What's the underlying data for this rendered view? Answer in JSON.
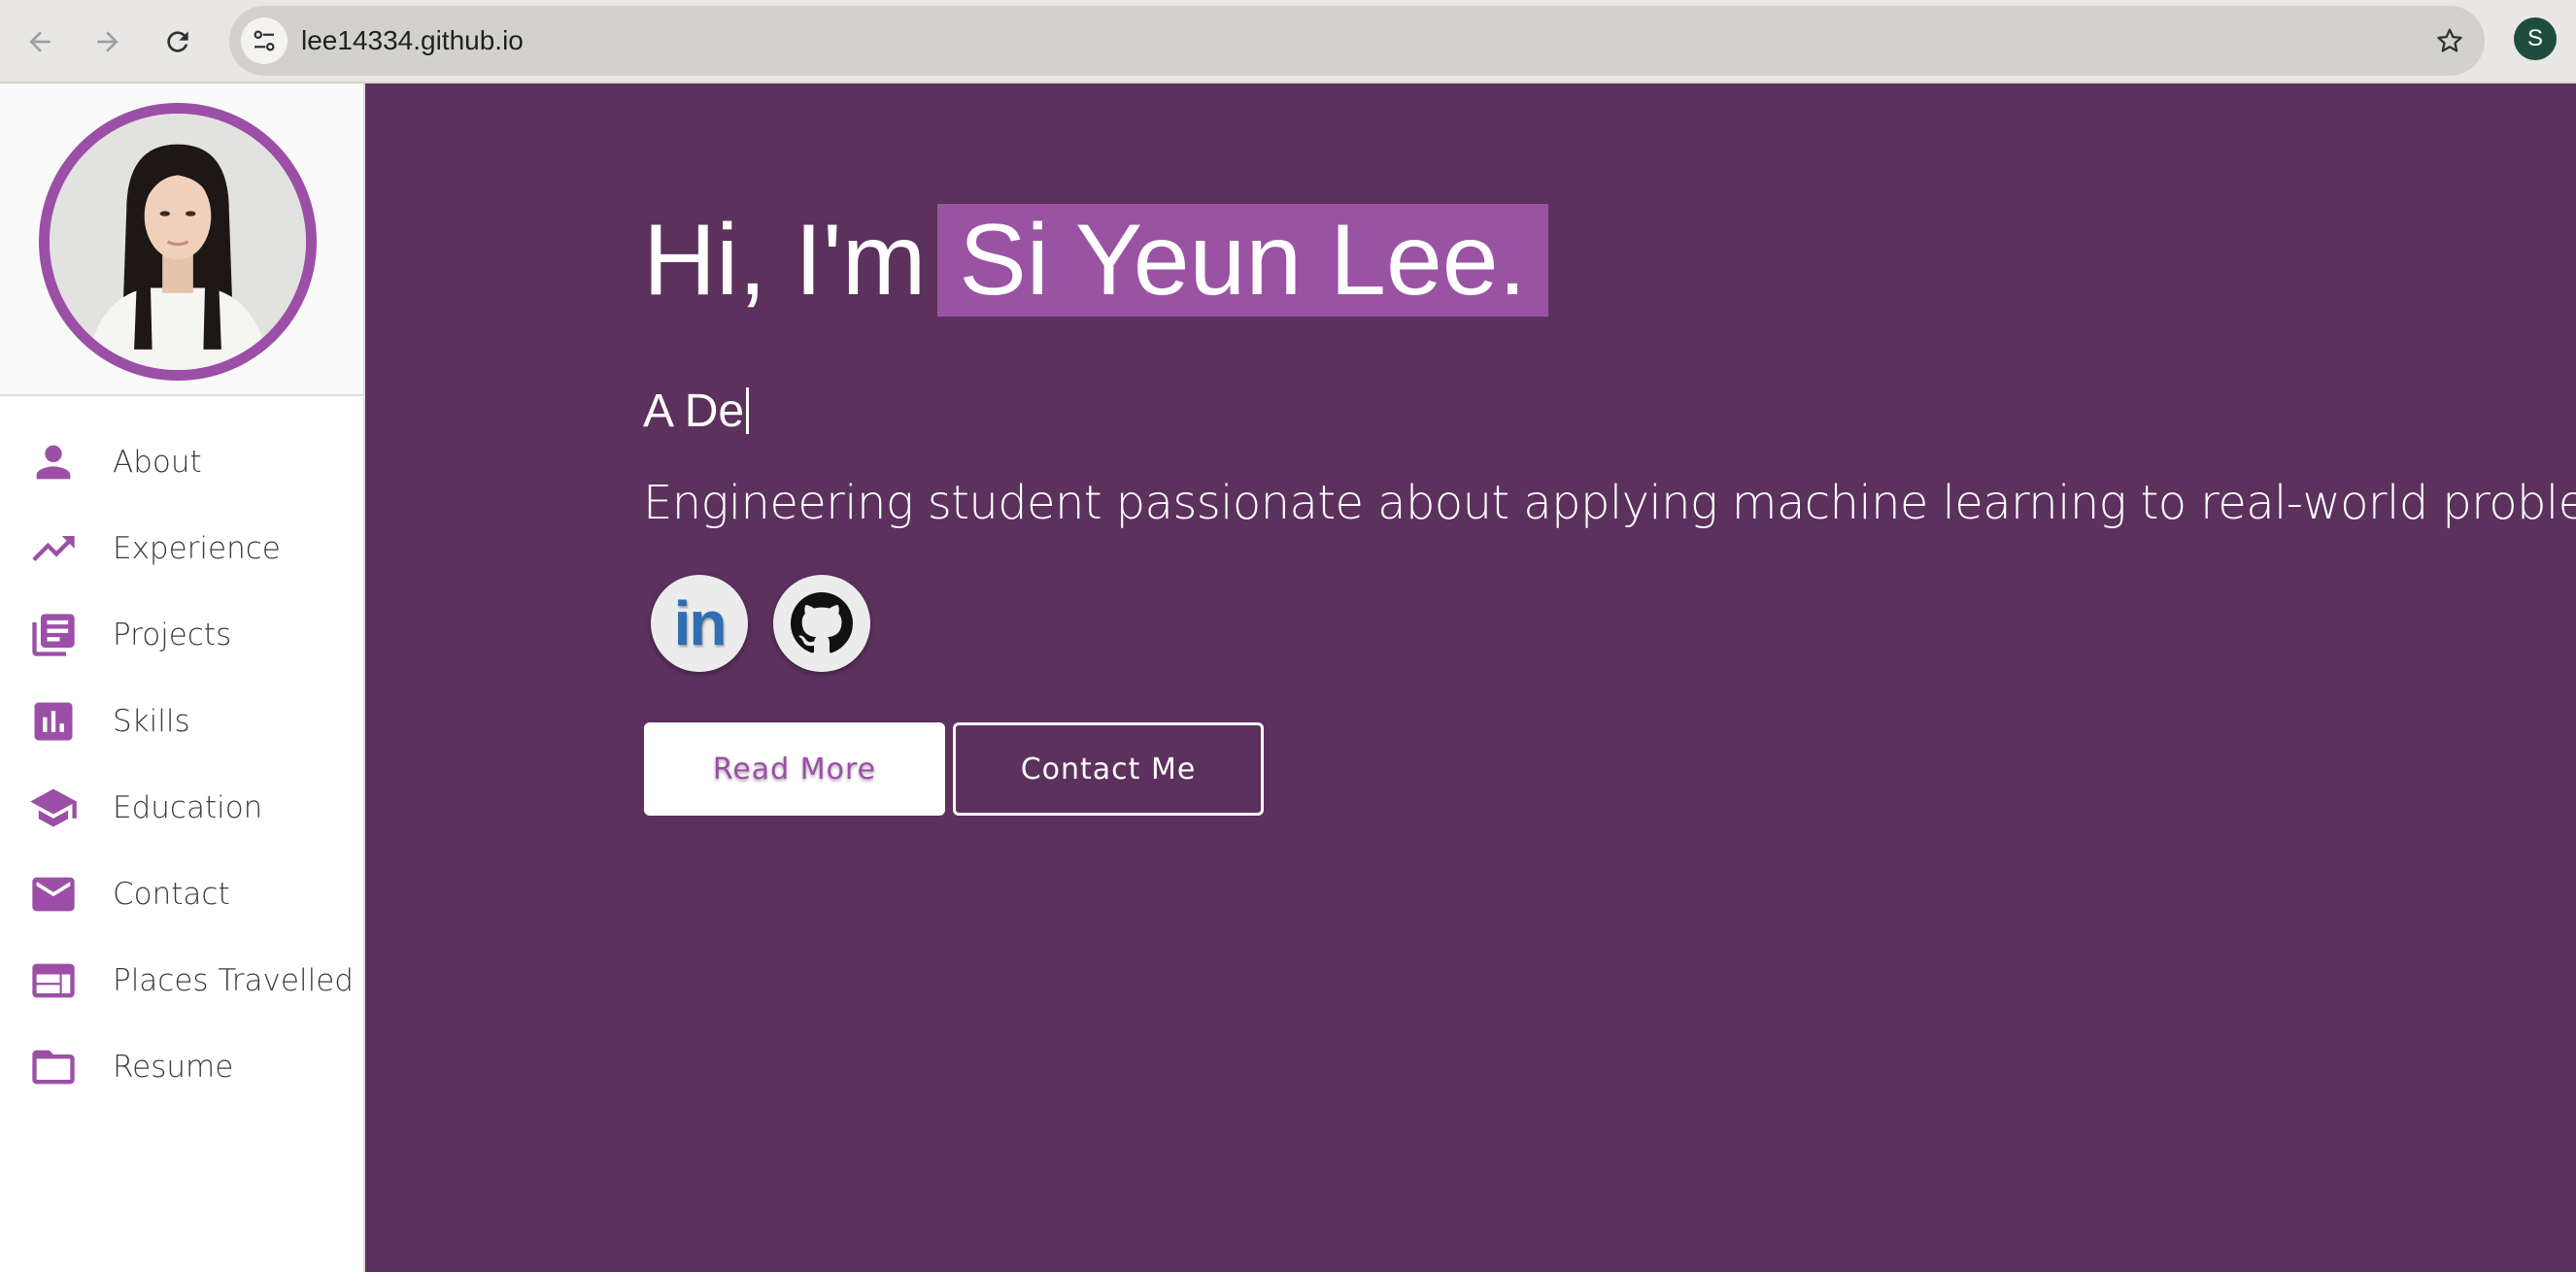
{
  "browser": {
    "url": "lee14334.github.io",
    "profile_initial": "S",
    "icons": [
      "back-arrow-icon",
      "forward-arrow-icon",
      "reload-icon",
      "site-settings-icon",
      "bookmark-star-icon"
    ]
  },
  "sidebar": {
    "items": [
      {
        "label": "About",
        "icon": "person-icon"
      },
      {
        "label": "Experience",
        "icon": "trending-up-icon"
      },
      {
        "label": "Projects",
        "icon": "library-books-icon"
      },
      {
        "label": "Skills",
        "icon": "bar-chart-icon"
      },
      {
        "label": "Education",
        "icon": "graduation-cap-icon"
      },
      {
        "label": "Contact",
        "icon": "mail-icon"
      },
      {
        "label": "Places Travelled",
        "icon": "web-icon"
      },
      {
        "label": "Resume",
        "icon": "folder-icon"
      }
    ]
  },
  "hero": {
    "greeting": "Hi, I'm",
    "name": "Si Yeun Lee.",
    "typed_text": "A De",
    "description": "Engineering student passionate about applying machine learning to real-world problems.",
    "social": [
      {
        "name": "LinkedIn",
        "icon": "linkedin-icon",
        "text": "in"
      },
      {
        "name": "GitHub",
        "icon": "github-icon"
      }
    ],
    "buttons": {
      "read_more": "Read More",
      "contact_me": "Contact Me"
    }
  },
  "colors": {
    "accent": "#9b4fa6",
    "hero_bg": "#5c315e",
    "name_highlight": "#9a53a3",
    "sidebar_bg": "#ffffff"
  }
}
